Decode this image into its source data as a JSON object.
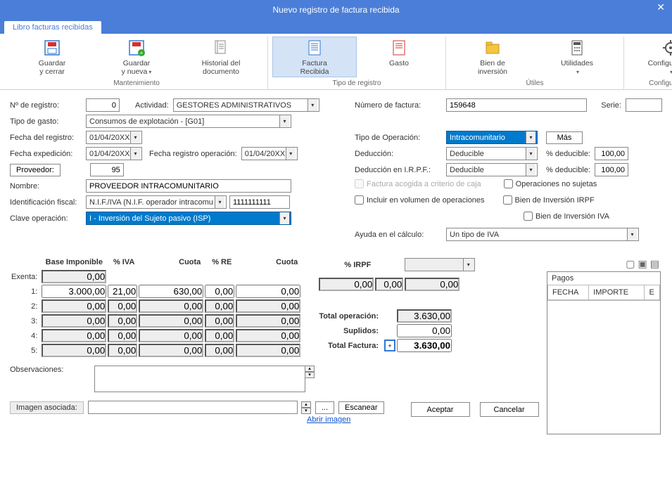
{
  "window": {
    "title": "Nuevo registro de factura recibida",
    "close": "✕"
  },
  "ribbon": {
    "tab": "Libro facturas recibidas",
    "groups": {
      "mantenimiento": {
        "label": "Mantenimiento",
        "guardar_cerrar": "Guardar\ny cerrar",
        "guardar_nueva": "Guardar\ny nueva",
        "historial": "Historial del\ndocumento"
      },
      "tipo_registro": {
        "label": "Tipo de registro",
        "factura": "Factura\nRecibida",
        "gasto": "Gasto"
      },
      "utiles": {
        "label": "Útiles",
        "bien": "Bien de\ninversión",
        "utilidades": "Utilidades"
      },
      "config": {
        "label": "Configuración",
        "config": "Configuración"
      }
    }
  },
  "form": {
    "n_registro_lbl": "Nº de registro:",
    "n_registro": "0",
    "actividad_lbl": "Actividad:",
    "actividad": "GESTORES ADMINISTRATIVOS",
    "num_factura_lbl": "Número de factura:",
    "num_factura": "159648",
    "serie_lbl": "Serie:",
    "serie": "",
    "tipo_gasto_lbl": "Tipo de gasto:",
    "tipo_gasto": "Consumos de explotación - [G01]",
    "fecha_registro_lbl": "Fecha del registro:",
    "fecha_registro": "01/04/20XX",
    "tipo_operacion_lbl": "Tipo de Operación:",
    "tipo_operacion": "Intracomunitario",
    "mas_btn": "Más",
    "fecha_expedicion_lbl": "Fecha expedición:",
    "fecha_expedicion": "01/04/20XX",
    "fecha_reg_op_lbl": "Fecha registro operación:",
    "fecha_reg_op": "01/04/20XX",
    "deduccion_lbl": "Deducción:",
    "deduccion": "Deducible",
    "pct_deducible_lbl": "% deducible:",
    "pct_deducible_1": "100,00",
    "proveedor_btn": "Proveedor:",
    "proveedor": "95",
    "ded_irpf_lbl": "Deducción en I.R.P.F.:",
    "ded_irpf": "Deducible",
    "pct_deducible_2": "100,00",
    "nombre_lbl": "Nombre:",
    "nombre": "PROVEEDOR INTRACOMUNITARIO",
    "chk_caja": "Factura acogida a criterio de caja",
    "chk_no_sujetas": "Operaciones no sujetas",
    "ident_fiscal_lbl": "Identificación fiscal:",
    "ident_fiscal": "N.I.F./IVA (N.I.F. operador intracomu",
    "nif": "1111111111",
    "chk_volumen": "Incluir en  volumen de operaciones",
    "chk_bien_irpf": "Bien de Inversión IRPF",
    "clave_op_lbl": "Clave operación:",
    "clave_op": "I - Inversión del Sujeto pasivo (ISP)",
    "chk_bien_iva": "Bien de Inversión IVA",
    "ayuda_lbl": "Ayuda en el cálculo:",
    "ayuda": "Un tipo de IVA"
  },
  "tax": {
    "hdr_base": "Base Imponible",
    "hdr_iva": "% IVA",
    "hdr_cuota": "Cuota",
    "hdr_re": "% RE",
    "hdr_cuota2": "Cuota",
    "hdr_irpf": "% IRPF",
    "rows": {
      "exenta": {
        "lbl": "Exenta:",
        "base": "0,00"
      },
      "r1": {
        "lbl": "1:",
        "base": "3.000,00",
        "iva": "21,00",
        "cuota": "630,00",
        "re": "0,00",
        "cuota2": "0,00"
      },
      "r2": {
        "lbl": "2:",
        "base": "0,00",
        "iva": "0,00",
        "cuota": "0,00",
        "re": "0,00",
        "cuota2": "0,00"
      },
      "r3": {
        "lbl": "3:",
        "base": "0,00",
        "iva": "0,00",
        "cuota": "0,00",
        "re": "0,00",
        "cuota2": "0,00"
      },
      "r4": {
        "lbl": "4:",
        "base": "0,00",
        "iva": "0,00",
        "cuota": "0,00",
        "re": "0,00",
        "cuota2": "0,00"
      },
      "r5": {
        "lbl": "5:",
        "base": "0,00",
        "iva": "0,00",
        "cuota": "0,00",
        "re": "0,00",
        "cuota2": "0,00"
      }
    },
    "irpf_base": "0,00",
    "irpf_pct": "0,00",
    "irpf_cuota": "0,00",
    "total_op_lbl": "Total operación:",
    "total_op": "3.630,00",
    "suplidos_lbl": "Suplidos:",
    "suplidos": "0,00",
    "total_fac_lbl": "Total Factura:",
    "sign": "+",
    "total_fac": "3.630,00"
  },
  "pagos": {
    "title": "Pagos",
    "col_fecha": "FECHA",
    "col_importe": "IMPORTE",
    "col_e": "E"
  },
  "bottom": {
    "obs_lbl": "Observaciones:",
    "obs": "",
    "img_lbl": "Imagen asociada:",
    "img": "",
    "browse": "...",
    "escanear": "Escanear",
    "abrir": "Abrir imagen",
    "aceptar": "Aceptar",
    "cancelar": "Cancelar"
  }
}
